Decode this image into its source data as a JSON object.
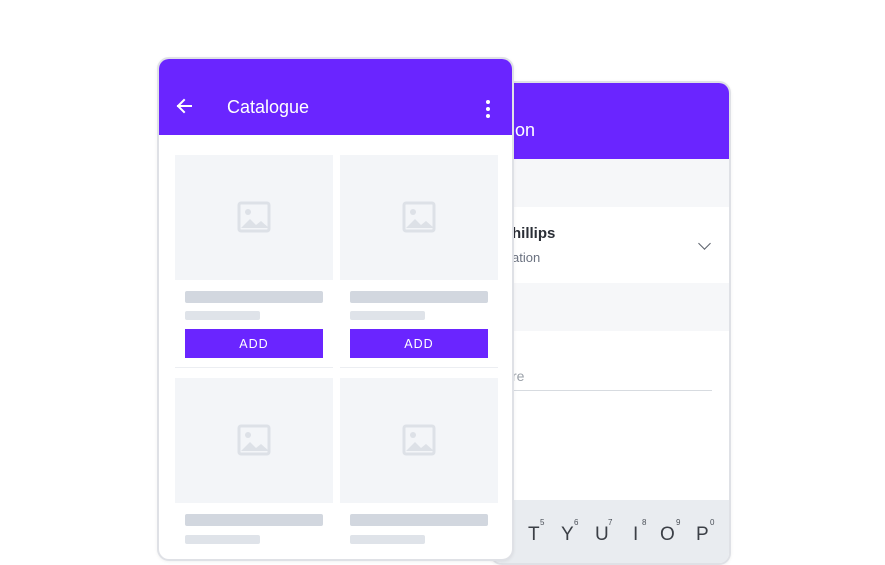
{
  "colors": {
    "accent": "#6a25ff",
    "placeholder_bg": "#f3f5f8",
    "skeleton": "#d2d7df"
  },
  "back_screen": {
    "title": "ation",
    "contact_name": "hillips",
    "contact_subtitle": "ation",
    "input_placeholder": "re",
    "keyboard": {
      "letters": [
        "T",
        "Y",
        "U",
        "I",
        "O",
        "P"
      ],
      "numbers": [
        "5",
        "6",
        "7",
        "8",
        "9",
        "0"
      ]
    }
  },
  "front_screen": {
    "title": "Catalogue",
    "back_icon": "arrow-left-icon",
    "menu_icon": "more-vert-icon",
    "products": [
      {
        "button_label": "ADD",
        "image_icon": "image-placeholder-icon"
      },
      {
        "button_label": "ADD",
        "image_icon": "image-placeholder-icon"
      },
      {
        "button_label": "",
        "image_icon": "image-placeholder-icon"
      },
      {
        "button_label": "",
        "image_icon": "image-placeholder-icon"
      }
    ]
  }
}
